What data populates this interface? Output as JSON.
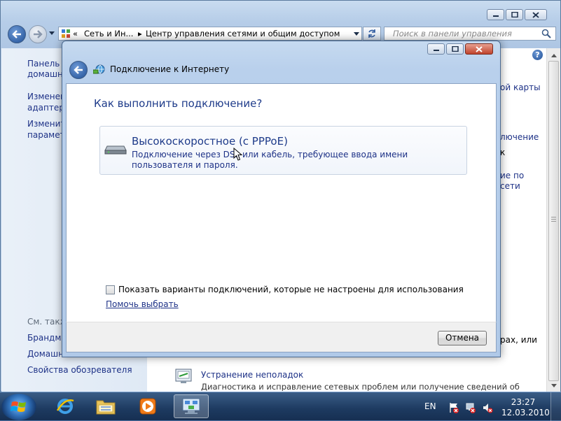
{
  "background_window": {
    "address_segments": [
      "«",
      "Сеть и Ин...",
      "Центр управления сетями и общим доступом"
    ],
    "search_placeholder": "Поиск в панели управления",
    "left_links": [
      "Панель у",
      "домашня",
      "Изменен",
      "адаптера",
      "Изменит",
      "параметр"
    ],
    "see_also_label": "См. такж",
    "see_also_links": [
      "Брандма",
      "Домашн",
      "Свойства обозревателя"
    ],
    "right_fragments": [
      "ой карты",
      "лючение",
      "к",
      "ие по",
      "сети",
      "рах, или"
    ],
    "troubleshoot_title": "Устранение неполадок",
    "troubleshoot_desc": "Диагностика и исправление сетевых проблем или получение сведений об"
  },
  "dialog": {
    "title": "Подключение к Интернету",
    "heading": "Как выполнить подключение?",
    "option": {
      "title": "Высокоскоростное (с PPPoE)",
      "description": "Подключение через DSL или кабель, требующее ввода имени пользователя и пароля."
    },
    "checkbox_label": "Показать варианты подключений, которые не настроены для использования",
    "checkbox_checked": false,
    "help_link": "Помочь выбрать",
    "cancel_label": "Отмена"
  },
  "taskbar": {
    "language": "EN",
    "time": "23:27",
    "date": "12.03.2010"
  },
  "icons": [
    "windows-start-icon",
    "internet-explorer-icon",
    "folder-icon",
    "media-player-icon",
    "network-center-icon",
    "network-icon",
    "action-center-icon",
    "volume-muted-icon",
    "modem-icon",
    "back-arrow-icon",
    "help-icon",
    "search-icon"
  ]
}
